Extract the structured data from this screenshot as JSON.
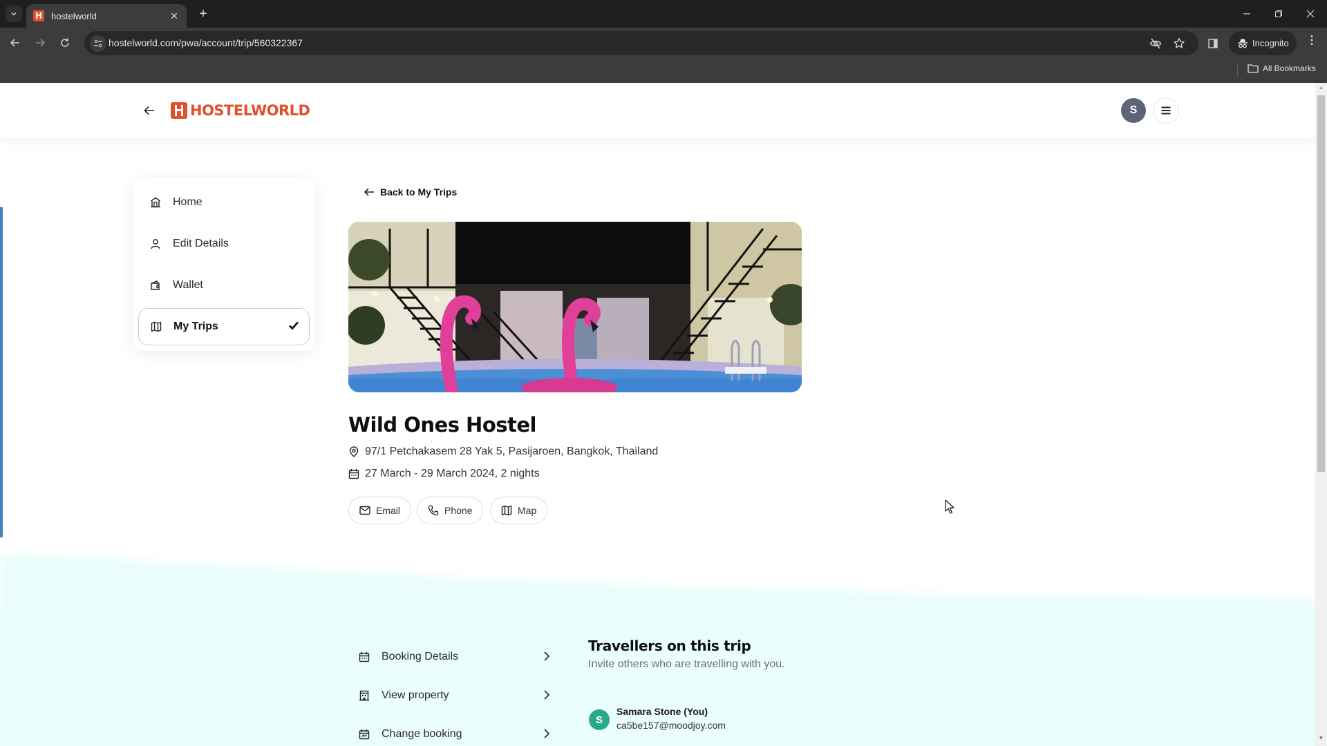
{
  "browser": {
    "tab_title": "hostelworld",
    "url": "hostelworld.com/pwa/account/trip/560322367",
    "incognito_label": "Incognito",
    "bookmarks_label": "All Bookmarks"
  },
  "header": {
    "logo_text": "HOSTELWORLD",
    "avatar_initial": "S"
  },
  "sidebar": {
    "items": [
      {
        "label": "Home",
        "icon": "home-icon",
        "active": false
      },
      {
        "label": "Edit Details",
        "icon": "user-icon",
        "active": false
      },
      {
        "label": "Wallet",
        "icon": "wallet-icon",
        "active": false
      },
      {
        "label": "My Trips",
        "icon": "map-icon",
        "active": true
      }
    ]
  },
  "trip": {
    "back_label": "Back to My Trips",
    "hero_alt": "Hostel pool with pink flamingo floats at night",
    "name": "Wild Ones Hostel",
    "address": "97/1 Petchakasem 28 Yak 5, Pasijaroen, Bangkok, Thailand",
    "dates": "27 March - 29 March 2024, 2 nights",
    "actions": [
      {
        "label": "Email",
        "icon": "mail-icon"
      },
      {
        "label": "Phone",
        "icon": "phone-icon"
      },
      {
        "label": "Map",
        "icon": "map-icon"
      }
    ]
  },
  "booking_links": [
    {
      "label": "Booking Details",
      "icon": "calendar-icon"
    },
    {
      "label": "View property",
      "icon": "building-icon"
    },
    {
      "label": "Change booking",
      "icon": "calendar-change-icon"
    }
  ],
  "travellers": {
    "title": "Travellers on this trip",
    "subtitle": "Invite others who are travelling with you.",
    "list": [
      {
        "initial": "S",
        "name": "Samara Stone (You)",
        "email": "ca5be157@moodjoy.com",
        "color": "#2aa88a"
      }
    ]
  },
  "colors": {
    "brand": "#e0502c",
    "mint_bg": "#eafefc",
    "avatar_bg": "#5d6478"
  }
}
